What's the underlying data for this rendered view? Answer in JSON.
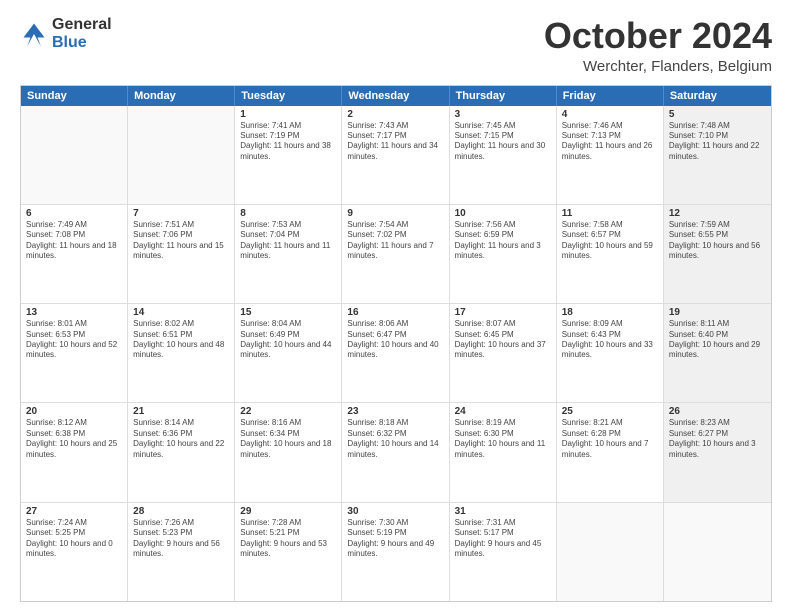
{
  "logo": {
    "general": "General",
    "blue": "Blue"
  },
  "header": {
    "month": "October 2024",
    "location": "Werchter, Flanders, Belgium"
  },
  "weekdays": [
    "Sunday",
    "Monday",
    "Tuesday",
    "Wednesday",
    "Thursday",
    "Friday",
    "Saturday"
  ],
  "rows": [
    [
      {
        "day": "",
        "sunrise": "",
        "sunset": "",
        "daylight": "",
        "shaded": false,
        "empty": true
      },
      {
        "day": "",
        "sunrise": "",
        "sunset": "",
        "daylight": "",
        "shaded": false,
        "empty": true
      },
      {
        "day": "1",
        "sunrise": "Sunrise: 7:41 AM",
        "sunset": "Sunset: 7:19 PM",
        "daylight": "Daylight: 11 hours and 38 minutes.",
        "shaded": false,
        "empty": false
      },
      {
        "day": "2",
        "sunrise": "Sunrise: 7:43 AM",
        "sunset": "Sunset: 7:17 PM",
        "daylight": "Daylight: 11 hours and 34 minutes.",
        "shaded": false,
        "empty": false
      },
      {
        "day": "3",
        "sunrise": "Sunrise: 7:45 AM",
        "sunset": "Sunset: 7:15 PM",
        "daylight": "Daylight: 11 hours and 30 minutes.",
        "shaded": false,
        "empty": false
      },
      {
        "day": "4",
        "sunrise": "Sunrise: 7:46 AM",
        "sunset": "Sunset: 7:13 PM",
        "daylight": "Daylight: 11 hours and 26 minutes.",
        "shaded": false,
        "empty": false
      },
      {
        "day": "5",
        "sunrise": "Sunrise: 7:48 AM",
        "sunset": "Sunset: 7:10 PM",
        "daylight": "Daylight: 11 hours and 22 minutes.",
        "shaded": true,
        "empty": false
      }
    ],
    [
      {
        "day": "6",
        "sunrise": "Sunrise: 7:49 AM",
        "sunset": "Sunset: 7:08 PM",
        "daylight": "Daylight: 11 hours and 18 minutes.",
        "shaded": false,
        "empty": false
      },
      {
        "day": "7",
        "sunrise": "Sunrise: 7:51 AM",
        "sunset": "Sunset: 7:06 PM",
        "daylight": "Daylight: 11 hours and 15 minutes.",
        "shaded": false,
        "empty": false
      },
      {
        "day": "8",
        "sunrise": "Sunrise: 7:53 AM",
        "sunset": "Sunset: 7:04 PM",
        "daylight": "Daylight: 11 hours and 11 minutes.",
        "shaded": false,
        "empty": false
      },
      {
        "day": "9",
        "sunrise": "Sunrise: 7:54 AM",
        "sunset": "Sunset: 7:02 PM",
        "daylight": "Daylight: 11 hours and 7 minutes.",
        "shaded": false,
        "empty": false
      },
      {
        "day": "10",
        "sunrise": "Sunrise: 7:56 AM",
        "sunset": "Sunset: 6:59 PM",
        "daylight": "Daylight: 11 hours and 3 minutes.",
        "shaded": false,
        "empty": false
      },
      {
        "day": "11",
        "sunrise": "Sunrise: 7:58 AM",
        "sunset": "Sunset: 6:57 PM",
        "daylight": "Daylight: 10 hours and 59 minutes.",
        "shaded": false,
        "empty": false
      },
      {
        "day": "12",
        "sunrise": "Sunrise: 7:59 AM",
        "sunset": "Sunset: 6:55 PM",
        "daylight": "Daylight: 10 hours and 56 minutes.",
        "shaded": true,
        "empty": false
      }
    ],
    [
      {
        "day": "13",
        "sunrise": "Sunrise: 8:01 AM",
        "sunset": "Sunset: 6:53 PM",
        "daylight": "Daylight: 10 hours and 52 minutes.",
        "shaded": false,
        "empty": false
      },
      {
        "day": "14",
        "sunrise": "Sunrise: 8:02 AM",
        "sunset": "Sunset: 6:51 PM",
        "daylight": "Daylight: 10 hours and 48 minutes.",
        "shaded": false,
        "empty": false
      },
      {
        "day": "15",
        "sunrise": "Sunrise: 8:04 AM",
        "sunset": "Sunset: 6:49 PM",
        "daylight": "Daylight: 10 hours and 44 minutes.",
        "shaded": false,
        "empty": false
      },
      {
        "day": "16",
        "sunrise": "Sunrise: 8:06 AM",
        "sunset": "Sunset: 6:47 PM",
        "daylight": "Daylight: 10 hours and 40 minutes.",
        "shaded": false,
        "empty": false
      },
      {
        "day": "17",
        "sunrise": "Sunrise: 8:07 AM",
        "sunset": "Sunset: 6:45 PM",
        "daylight": "Daylight: 10 hours and 37 minutes.",
        "shaded": false,
        "empty": false
      },
      {
        "day": "18",
        "sunrise": "Sunrise: 8:09 AM",
        "sunset": "Sunset: 6:43 PM",
        "daylight": "Daylight: 10 hours and 33 minutes.",
        "shaded": false,
        "empty": false
      },
      {
        "day": "19",
        "sunrise": "Sunrise: 8:11 AM",
        "sunset": "Sunset: 6:40 PM",
        "daylight": "Daylight: 10 hours and 29 minutes.",
        "shaded": true,
        "empty": false
      }
    ],
    [
      {
        "day": "20",
        "sunrise": "Sunrise: 8:12 AM",
        "sunset": "Sunset: 6:38 PM",
        "daylight": "Daylight: 10 hours and 25 minutes.",
        "shaded": false,
        "empty": false
      },
      {
        "day": "21",
        "sunrise": "Sunrise: 8:14 AM",
        "sunset": "Sunset: 6:36 PM",
        "daylight": "Daylight: 10 hours and 22 minutes.",
        "shaded": false,
        "empty": false
      },
      {
        "day": "22",
        "sunrise": "Sunrise: 8:16 AM",
        "sunset": "Sunset: 6:34 PM",
        "daylight": "Daylight: 10 hours and 18 minutes.",
        "shaded": false,
        "empty": false
      },
      {
        "day": "23",
        "sunrise": "Sunrise: 8:18 AM",
        "sunset": "Sunset: 6:32 PM",
        "daylight": "Daylight: 10 hours and 14 minutes.",
        "shaded": false,
        "empty": false
      },
      {
        "day": "24",
        "sunrise": "Sunrise: 8:19 AM",
        "sunset": "Sunset: 6:30 PM",
        "daylight": "Daylight: 10 hours and 11 minutes.",
        "shaded": false,
        "empty": false
      },
      {
        "day": "25",
        "sunrise": "Sunrise: 8:21 AM",
        "sunset": "Sunset: 6:28 PM",
        "daylight": "Daylight: 10 hours and 7 minutes.",
        "shaded": false,
        "empty": false
      },
      {
        "day": "26",
        "sunrise": "Sunrise: 8:23 AM",
        "sunset": "Sunset: 6:27 PM",
        "daylight": "Daylight: 10 hours and 3 minutes.",
        "shaded": true,
        "empty": false
      }
    ],
    [
      {
        "day": "27",
        "sunrise": "Sunrise: 7:24 AM",
        "sunset": "Sunset: 5:25 PM",
        "daylight": "Daylight: 10 hours and 0 minutes.",
        "shaded": false,
        "empty": false
      },
      {
        "day": "28",
        "sunrise": "Sunrise: 7:26 AM",
        "sunset": "Sunset: 5:23 PM",
        "daylight": "Daylight: 9 hours and 56 minutes.",
        "shaded": false,
        "empty": false
      },
      {
        "day": "29",
        "sunrise": "Sunrise: 7:28 AM",
        "sunset": "Sunset: 5:21 PM",
        "daylight": "Daylight: 9 hours and 53 minutes.",
        "shaded": false,
        "empty": false
      },
      {
        "day": "30",
        "sunrise": "Sunrise: 7:30 AM",
        "sunset": "Sunset: 5:19 PM",
        "daylight": "Daylight: 9 hours and 49 minutes.",
        "shaded": false,
        "empty": false
      },
      {
        "day": "31",
        "sunrise": "Sunrise: 7:31 AM",
        "sunset": "Sunset: 5:17 PM",
        "daylight": "Daylight: 9 hours and 45 minutes.",
        "shaded": false,
        "empty": false
      },
      {
        "day": "",
        "sunrise": "",
        "sunset": "",
        "daylight": "",
        "shaded": false,
        "empty": true
      },
      {
        "day": "",
        "sunrise": "",
        "sunset": "",
        "daylight": "",
        "shaded": true,
        "empty": true
      }
    ]
  ]
}
